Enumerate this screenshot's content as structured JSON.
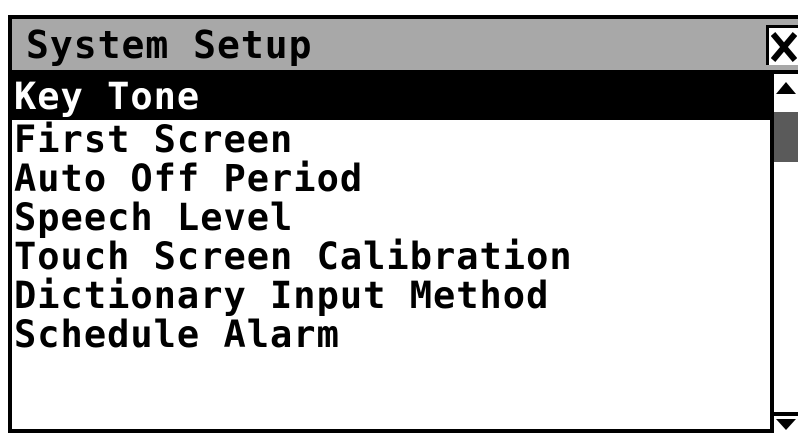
{
  "window": {
    "title": "System Setup"
  },
  "menu": {
    "items": [
      {
        "label": "Key Tone",
        "selected": true
      },
      {
        "label": "First Screen",
        "selected": false
      },
      {
        "label": "Auto Off Period",
        "selected": false
      },
      {
        "label": "Speech Level",
        "selected": false
      },
      {
        "label": "Touch Screen Calibration",
        "selected": false
      },
      {
        "label": "Dictionary Input Method",
        "selected": false
      },
      {
        "label": "Schedule Alarm",
        "selected": false
      }
    ]
  },
  "icons": {
    "close": "close-icon",
    "scroll_up": "scroll-up-arrow-icon",
    "scroll_down": "scroll-down-arrow-icon"
  },
  "colors": {
    "titlebar": "#a8a8a8",
    "selection_bg": "#000000",
    "selection_fg": "#ffffff",
    "scroll_thumb": "#5a5a5a"
  }
}
